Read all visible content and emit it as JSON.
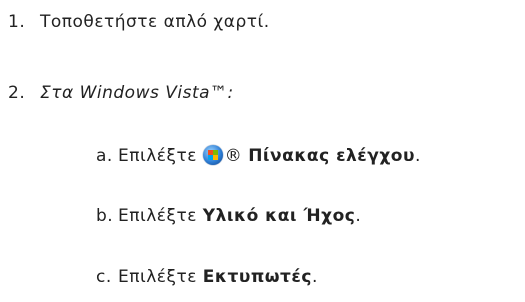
{
  "steps": [
    {
      "num": "1.",
      "text": "Τοποθετήστε απλό χαρτί."
    },
    {
      "num": "2.",
      "text": "Στα Windows Vista™:"
    }
  ],
  "substeps": [
    {
      "num": "a.",
      "prefix": "Επιλέξτε ",
      "after_icon": "® ",
      "bold": "Πίνακας ελέγχου",
      "suffix": "."
    },
    {
      "num": "b.",
      "prefix": "Επιλέξτε ",
      "bold": "Υλικό και Ήχος",
      "suffix": "."
    },
    {
      "num": "c.",
      "prefix": "Επιλέξτε ",
      "bold": "Εκτυπωτές",
      "suffix": "."
    }
  ],
  "icons": {
    "start_button": "windows-start-icon"
  },
  "colors": {
    "text": "#222222",
    "background": "#ffffff"
  }
}
